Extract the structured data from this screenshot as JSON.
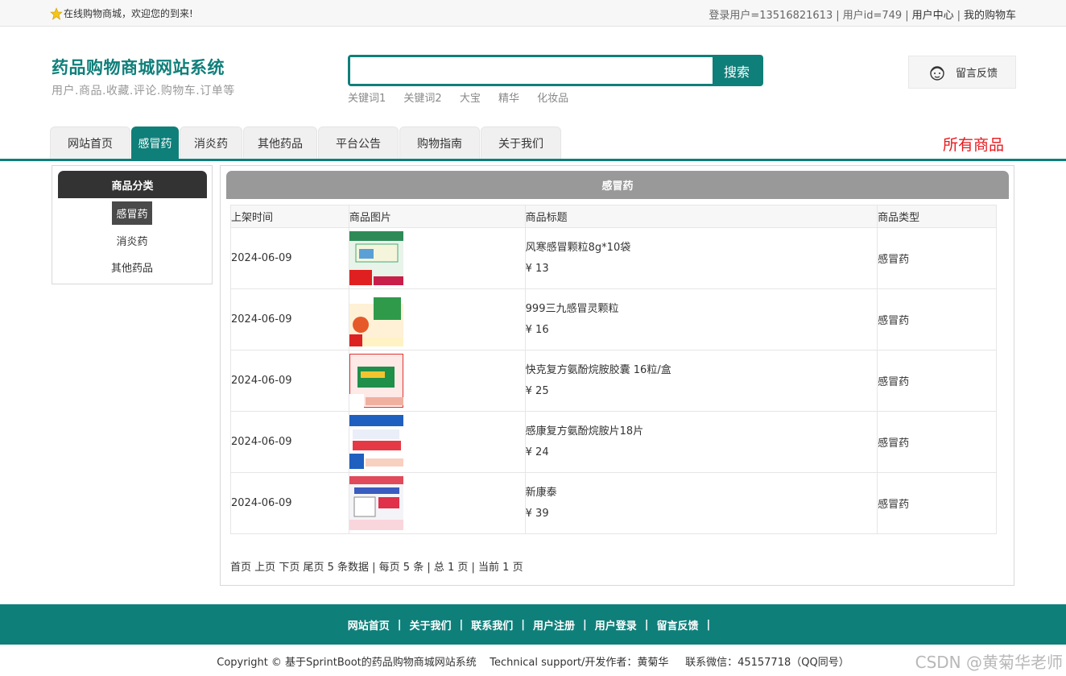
{
  "topbar": {
    "welcome": "在线购物商城，欢迎您的到来!",
    "login_user": "登录用户=13516821613",
    "user_id": "用户id=749",
    "user_center": "用户中心",
    "cart": "我的购物车"
  },
  "logo": {
    "title": "药品购物商城网站系统",
    "subtitle": "用户.商品.收藏.评论.购物车.订单等"
  },
  "search": {
    "value": "",
    "button": "搜索",
    "keywords": [
      "关键词1",
      "关键词2",
      "大宝",
      "精华",
      "化妆品"
    ]
  },
  "feedback": {
    "label": "留言反馈"
  },
  "nav": {
    "tabs": [
      {
        "label": "网站首页"
      },
      {
        "label": "感冒药"
      },
      {
        "label": "消炎药"
      },
      {
        "label": "其他药品"
      },
      {
        "label": "平台公告"
      },
      {
        "label": "购物指南"
      },
      {
        "label": "关于我们"
      }
    ],
    "active_index": 1,
    "all_goods": "所有商品"
  },
  "sidebar": {
    "title": "商品分类",
    "categories": [
      "感冒药",
      "消炎药",
      "其他药品"
    ],
    "active_index": 0
  },
  "main": {
    "title": "感冒药",
    "columns": [
      "上架时间",
      "商品图片",
      "商品标题",
      "商品类型"
    ],
    "rows": [
      {
        "date": "2024-06-09",
        "title": "风寒感冒颗粒8g*10袋",
        "price": "¥ 13",
        "type": "感冒药"
      },
      {
        "date": "2024-06-09",
        "title": "999三九感冒灵颗粒",
        "price": "¥ 16",
        "type": "感冒药"
      },
      {
        "date": "2024-06-09",
        "title": "快克复方氨酚烷胺胶囊 16粒/盒",
        "price": "¥ 25",
        "type": "感冒药"
      },
      {
        "date": "2024-06-09",
        "title": "感康复方氨酚烷胺片18片",
        "price": "¥ 24",
        "type": "感冒药"
      },
      {
        "date": "2024-06-09",
        "title": "新康泰",
        "price": "¥ 39",
        "type": "感冒药"
      }
    ],
    "pager": {
      "first": "首页",
      "prev": "上页",
      "next": "下页",
      "last": "尾页",
      "info": "5 条数据 | 每页 5 条 | 总 1 页 | 当前 1 页"
    }
  },
  "footer": {
    "links": [
      "网站首页",
      "关于我们",
      "联系我们",
      "用户注册",
      "用户登录",
      "留言反馈"
    ],
    "copyright": "Copyright © 基于SprintBoot的药品购物商城网站系统    Technical support/开发作者：黄菊华     联系微信：45157718（QQ同号）"
  },
  "watermark": "CSDN @黄菊华老师",
  "colors": {
    "accent": "#0f7f7a",
    "all_goods": "#e8191c"
  }
}
